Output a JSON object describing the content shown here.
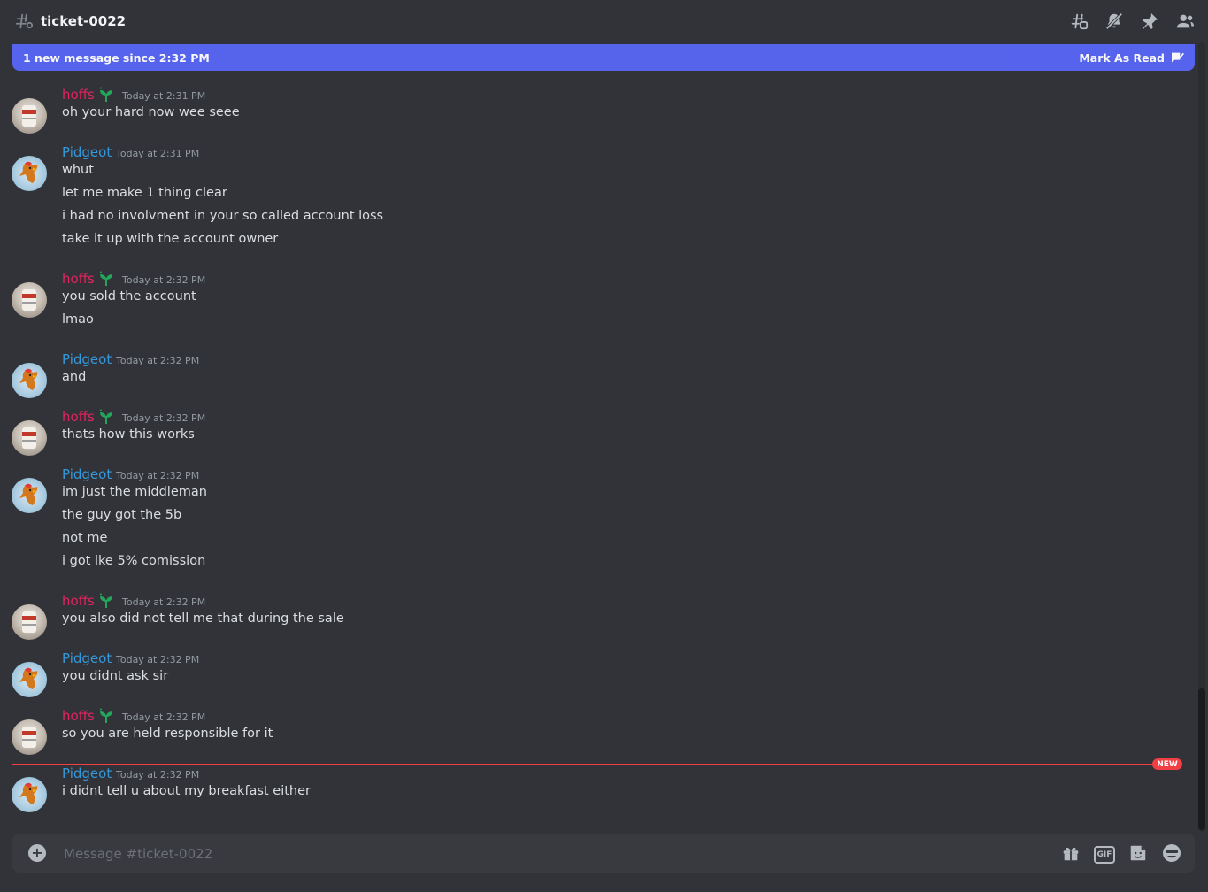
{
  "channel": {
    "name": "ticket-0022"
  },
  "header_icons": [
    "threads-icon",
    "mute-icon",
    "pin-icon",
    "members-icon"
  ],
  "ghost_lines": [
    "",
    ""
  ],
  "new_messages_bar": {
    "text": "1 new message since 2:32 PM",
    "mark_read": "Mark As Read"
  },
  "colors": {
    "hoffs": "#e0245e",
    "pidgeot": "#3498db",
    "accent": "#5865f2",
    "new": "#f23f43"
  },
  "messages": [
    {
      "author": "hoffs",
      "time": "Today at 2:31 PM",
      "lines": [
        "oh your hard now wee seee"
      ]
    },
    {
      "author": "Pidgeot",
      "time": "Today at 2:31 PM",
      "lines": [
        "whut",
        "let me make 1 thing clear",
        "i had no involvment in your so called account loss",
        "take it up with the account owner"
      ]
    },
    {
      "author": "hoffs",
      "time": "Today at 2:32 PM",
      "lines": [
        "you sold the account",
        "lmao"
      ]
    },
    {
      "author": "Pidgeot",
      "time": "Today at 2:32 PM",
      "lines": [
        "and"
      ]
    },
    {
      "author": "hoffs",
      "time": "Today at 2:32 PM",
      "lines": [
        "thats how this works"
      ]
    },
    {
      "author": "Pidgeot",
      "time": "Today at 2:32 PM",
      "lines": [
        "im just the middleman",
        "the guy got the 5b",
        "not me",
        "i got lke 5% comission"
      ]
    },
    {
      "author": "hoffs",
      "time": "Today at 2:32 PM",
      "lines": [
        "you also did not tell me that during the sale"
      ]
    },
    {
      "author": "Pidgeot",
      "time": "Today at 2:32 PM",
      "lines": [
        "you didnt ask sir"
      ]
    },
    {
      "author": "hoffs",
      "time": "Today at 2:32 PM",
      "lines": [
        "so you are held responsible for it"
      ]
    },
    {
      "author": "Pidgeot",
      "time": "Today at 2:32 PM",
      "lines": [
        "i didnt tell u about my breakfast either"
      ]
    }
  ],
  "new_divider": {
    "label": "NEW"
  },
  "composer": {
    "placeholder": "Message #ticket-0022",
    "icons": [
      "gift-icon",
      "gif-icon",
      "sticker-icon",
      "emoji-icon"
    ],
    "gif_label": "GIF"
  }
}
